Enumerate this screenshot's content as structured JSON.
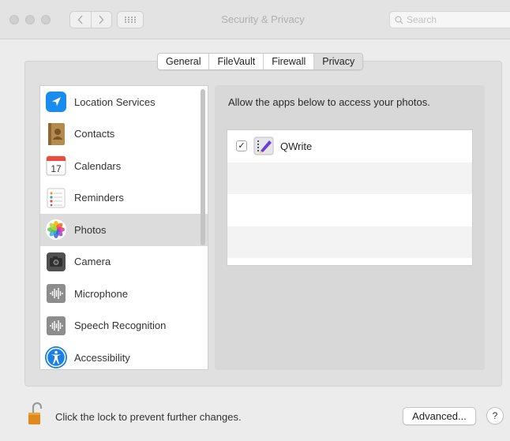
{
  "window": {
    "title": "Security & Privacy"
  },
  "toolbar": {
    "back_icon": "chevron-left-icon",
    "forward_icon": "chevron-right-icon",
    "show_all_icon": "grid-icon",
    "search_placeholder": "Search"
  },
  "tabs": [
    {
      "label": "General",
      "active": false
    },
    {
      "label": "FileVault",
      "active": false
    },
    {
      "label": "Firewall",
      "active": false
    },
    {
      "label": "Privacy",
      "active": true
    }
  ],
  "sidebar": {
    "selected": "Photos",
    "items": [
      {
        "label": "Location Services",
        "icon": "location-arrow-icon"
      },
      {
        "label": "Contacts",
        "icon": "contacts-book-icon"
      },
      {
        "label": "Calendars",
        "icon": "calendar-icon",
        "calendar_day": "17"
      },
      {
        "label": "Reminders",
        "icon": "reminders-list-icon"
      },
      {
        "label": "Photos",
        "icon": "photos-flower-icon"
      },
      {
        "label": "Camera",
        "icon": "camera-icon"
      },
      {
        "label": "Microphone",
        "icon": "microphone-waveform-icon"
      },
      {
        "label": "Speech Recognition",
        "icon": "speech-waveform-icon"
      },
      {
        "label": "Accessibility",
        "icon": "accessibility-figure-icon"
      }
    ]
  },
  "main": {
    "description": "Allow the apps below to access your photos.",
    "apps": [
      {
        "name": "QWrite",
        "checked": true,
        "check_glyph": "✓",
        "icon": "qwrite-app-icon"
      }
    ]
  },
  "footer": {
    "lock_text": "Click the lock to prevent further changes.",
    "lock_icon": "unlocked-padlock-icon",
    "advanced_label": "Advanced...",
    "help_label": "?"
  },
  "colors": {
    "window_bg": "#ececec",
    "selection": "#dcdcdc",
    "location_blue": "#1a8cf0",
    "accessibility_blue": "#1a7fe6"
  }
}
